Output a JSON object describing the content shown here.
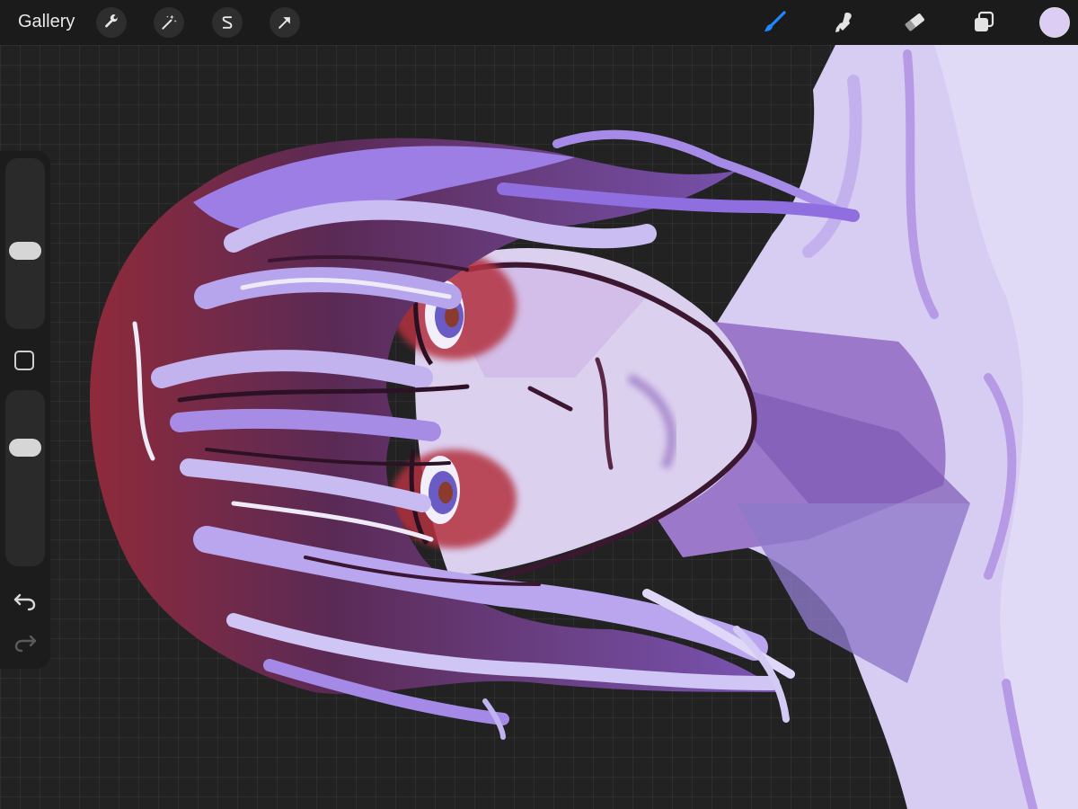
{
  "toolbar": {
    "gallery_label": "Gallery",
    "left_tools": [
      "wrench-icon",
      "magic-wand-icon",
      "selection-icon",
      "transform-arrow-icon"
    ],
    "right_tools": [
      "brush-icon",
      "smudge-icon",
      "eraser-icon",
      "layers-icon"
    ],
    "active_tool": "brush-icon",
    "accent_color": "#1e88ff",
    "current_color": "#dccdf4"
  },
  "sidebar": {
    "brush_size_level": 0.45,
    "opacity_level": 0.7,
    "controls": [
      "brush-size-slider",
      "modify-button",
      "opacity-slider",
      "undo-icon",
      "redo-icon"
    ]
  },
  "canvas": {
    "background_color": "#222222",
    "artwork_palette": [
      "#b9a8ef",
      "#8f63d9",
      "#e7e0f6",
      "#b03a45",
      "#3d1a2e"
    ]
  }
}
